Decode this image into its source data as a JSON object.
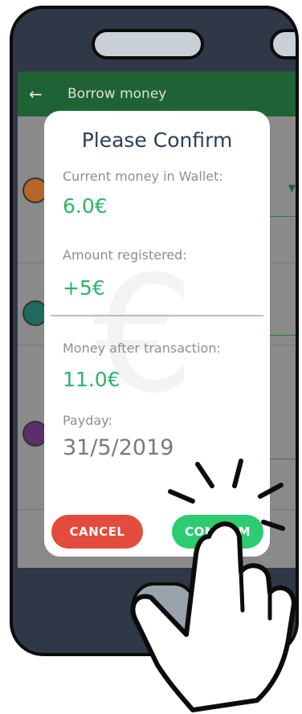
{
  "appbar": {
    "title": "Borrow money",
    "back_icon": "arrow-left-icon"
  },
  "dialog": {
    "title": "Please Confirm",
    "current_money_label": "Current money in Wallet:",
    "current_money_value": "6.0€",
    "amount_label": "Amount registered:",
    "amount_value": "+5€",
    "after_label": "Money after transaction:",
    "after_value": "11.0€",
    "payday_label": "Payday:",
    "payday_value": "31/5/2019",
    "cancel_label": "CANCEL",
    "confirm_label": "CONFIRM"
  },
  "colors": {
    "appbar": "#1f6235",
    "positive": "#2bb56a",
    "cancel": "#e34b3c",
    "confirm": "#2ecc71",
    "title": "#2e3e56"
  }
}
